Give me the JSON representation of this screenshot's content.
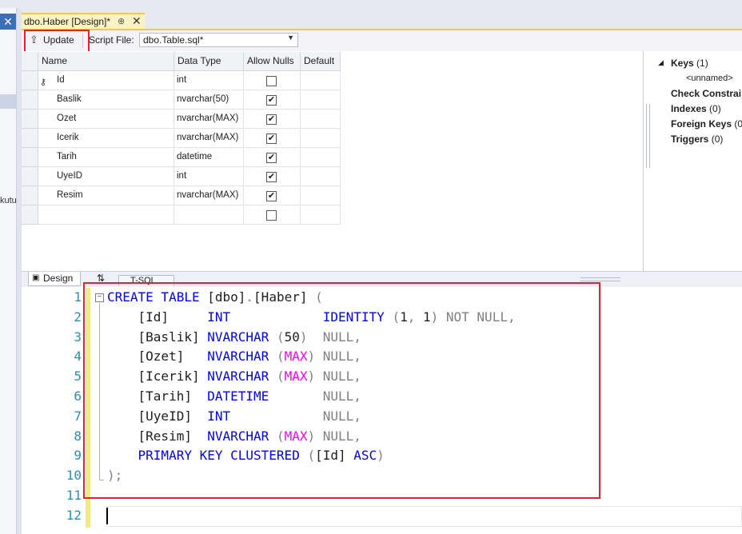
{
  "tab": {
    "title": "dbo.Haber [Design]*",
    "pin": "⊕",
    "close": "✕"
  },
  "left": {
    "close": "✕",
    "stub": "kutu"
  },
  "toolbar": {
    "update_label": "Update",
    "script_file_label": "Script File:",
    "script_file_value": "dbo.Table.sql*"
  },
  "grid": {
    "headers": [
      "Name",
      "Data Type",
      "Allow Nulls",
      "Default"
    ],
    "rows": [
      {
        "name": "Id",
        "type": "int",
        "nulls": false,
        "key": true
      },
      {
        "name": "Baslik",
        "type": "nvarchar(50)",
        "nulls": true
      },
      {
        "name": "Ozet",
        "type": "nvarchar(MAX)",
        "nulls": true
      },
      {
        "name": "Icerik",
        "type": "nvarchar(MAX)",
        "nulls": true
      },
      {
        "name": "Tarih",
        "type": "datetime",
        "nulls": true
      },
      {
        "name": "UyeID",
        "type": "int",
        "nulls": true
      },
      {
        "name": "Resim",
        "type": "nvarchar(MAX)",
        "nulls": true
      },
      {
        "name": "",
        "type": "",
        "nulls": false
      }
    ]
  },
  "properties": {
    "keys_label": "Keys",
    "keys_count": "(1)",
    "keys_child": "<unnamed>",
    "check_label": "Check Constrai",
    "indexes_label": "Indexes",
    "indexes_count": "(0)",
    "fk_label": "Foreign Keys",
    "fk_count": "(0",
    "triggers_label": "Triggers",
    "triggers_count": "(0)"
  },
  "bottom_tabs": {
    "design": "Design",
    "tsql": "T-SQL"
  },
  "editor": {
    "line_numbers": [
      "1",
      "2",
      "3",
      "4",
      "5",
      "6",
      "7",
      "8",
      "9",
      "10",
      "11",
      "12"
    ],
    "lines": [
      [
        [
          "kw",
          "CREATE TABLE "
        ],
        [
          "",
          "[dbo]"
        ],
        [
          "gr",
          "."
        ],
        [
          "",
          "[Haber] "
        ],
        [
          "gr",
          "("
        ]
      ],
      [
        [
          "",
          "    [Id]     "
        ],
        [
          "kw",
          "INT"
        ],
        [
          "",
          "            "
        ],
        [
          "kw",
          "IDENTITY "
        ],
        [
          "gr",
          "("
        ],
        [
          "",
          "1"
        ],
        [
          "gr",
          ", "
        ],
        [
          "",
          "1"
        ],
        [
          "gr",
          ") NOT NULL,"
        ]
      ],
      [
        [
          "",
          "    [Baslik] "
        ],
        [
          "kw",
          "NVARCHAR "
        ],
        [
          "gr",
          "("
        ],
        [
          "",
          "50"
        ],
        [
          "gr",
          ")  NULL,"
        ]
      ],
      [
        [
          "",
          "    [Ozet]   "
        ],
        [
          "kw",
          "NVARCHAR "
        ],
        [
          "gr",
          "("
        ],
        [
          "mg",
          "MAX"
        ],
        [
          "gr",
          ") NULL,"
        ]
      ],
      [
        [
          "",
          "    [Icerik] "
        ],
        [
          "kw",
          "NVARCHAR "
        ],
        [
          "gr",
          "("
        ],
        [
          "mg",
          "MAX"
        ],
        [
          "gr",
          ") NULL,"
        ]
      ],
      [
        [
          "",
          "    [Tarih]  "
        ],
        [
          "kw",
          "DATETIME"
        ],
        [
          "",
          "       "
        ],
        [
          "gr",
          "NULL,"
        ]
      ],
      [
        [
          "",
          "    [UyeID]  "
        ],
        [
          "kw",
          "INT"
        ],
        [
          "",
          "            "
        ],
        [
          "gr",
          "NULL,"
        ]
      ],
      [
        [
          "",
          "    [Resim]  "
        ],
        [
          "kw",
          "NVARCHAR "
        ],
        [
          "gr",
          "("
        ],
        [
          "mg",
          "MAX"
        ],
        [
          "gr",
          ") NULL,"
        ]
      ],
      [
        [
          "",
          "    "
        ],
        [
          "kw",
          "PRIMARY KEY CLUSTERED "
        ],
        [
          "gr",
          "("
        ],
        [
          "",
          "[Id] "
        ],
        [
          "kw",
          "ASC"
        ],
        [
          "gr",
          ")"
        ]
      ],
      [
        [
          "gr",
          ");"
        ]
      ],
      [],
      []
    ]
  }
}
